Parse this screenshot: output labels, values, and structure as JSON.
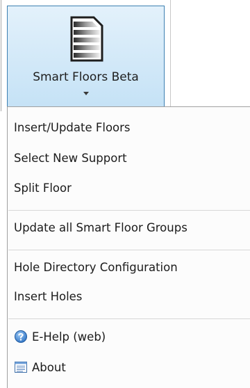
{
  "ribbon": {
    "button_label": "Smart Floors Beta",
    "icon": "floors-stack-icon",
    "has_dropdown": true
  },
  "menu": {
    "items": [
      {
        "label": "Insert/Update Floors"
      },
      {
        "label": "Select New Support"
      },
      {
        "label": "Split Floor"
      },
      {
        "label": "Update all Smart Floor Groups"
      },
      {
        "label": "Hole Directory Configuration"
      },
      {
        "label": "Insert Holes"
      },
      {
        "label": "E-Help (web)",
        "icon": "help-icon"
      },
      {
        "label": "About",
        "icon": "about-window-icon"
      }
    ]
  },
  "colors": {
    "button_border": "#3c7fb1",
    "button_fill": "#c5e2f6",
    "help_icon": "#2f73c4"
  }
}
